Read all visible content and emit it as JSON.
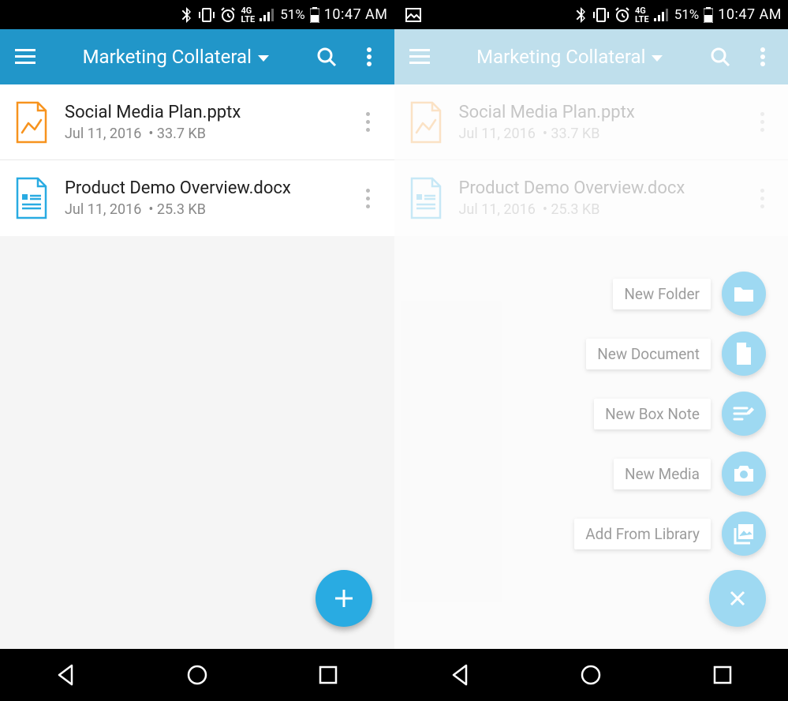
{
  "status_bar": {
    "battery_pct": "51%",
    "time": "10:47 AM",
    "network": "4G LTE"
  },
  "app_bar": {
    "title": "Marketing Collateral"
  },
  "files": [
    {
      "name": "Social Media Plan.pptx",
      "date": "Jul 11, 2016",
      "size": "33.7 KB",
      "type": "pptx"
    },
    {
      "name": "Product Demo Overview.docx",
      "date": "Jul 11, 2016",
      "size": "25.3 KB",
      "type": "docx"
    }
  ],
  "fab_menu": [
    {
      "label": "New Folder",
      "icon": "folder"
    },
    {
      "label": "New Document",
      "icon": "document"
    },
    {
      "label": "New Box Note",
      "icon": "note"
    },
    {
      "label": "New Media",
      "icon": "camera"
    },
    {
      "label": "Add From Library",
      "icon": "library"
    }
  ],
  "colors": {
    "primary": "#2196c9",
    "fab": "#29abe2",
    "pptx_icon": "#f7931e",
    "docx_icon": "#29abe2"
  }
}
